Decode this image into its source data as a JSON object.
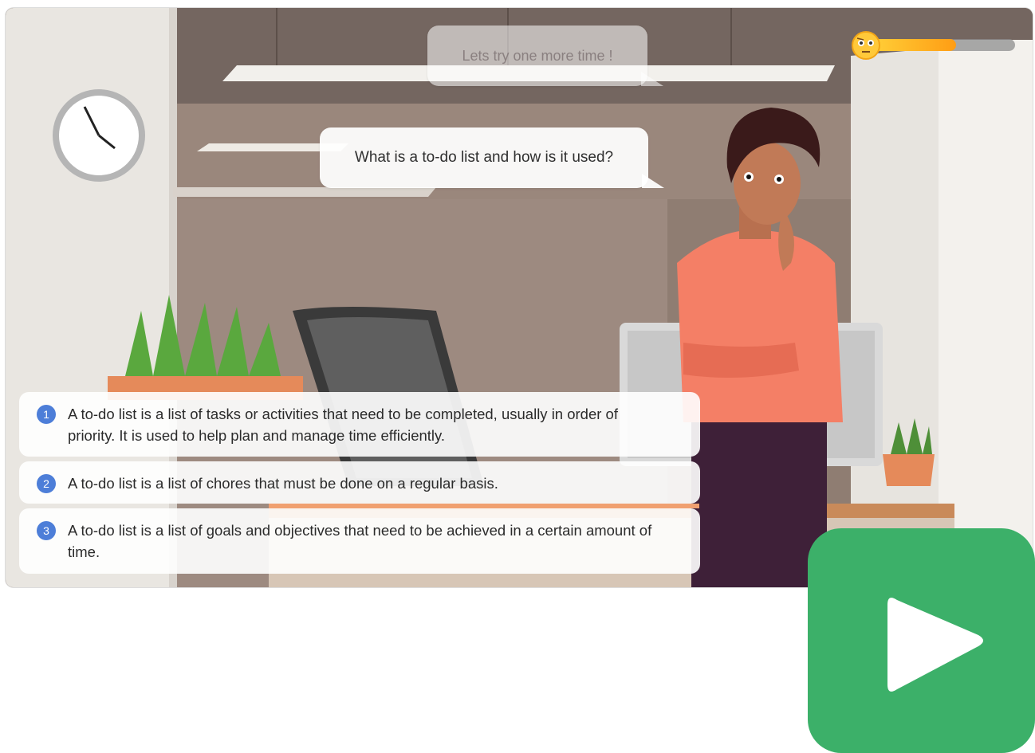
{
  "scene": {
    "previous_feedback": "Lets try one more time !",
    "question": "What is a to-do list and how is it used?"
  },
  "progress_meter": {
    "level": 0.6,
    "face_icon": "confused-face-icon"
  },
  "options": [
    {
      "number": "1",
      "text": "A to-do list is a list of tasks or activities that need to be completed, usually in order of priority. It is used to help plan and manage time efficiently."
    },
    {
      "number": "2",
      "text": "A to-do list is a list of chores that must be done on a regular basis."
    },
    {
      "number": "3",
      "text": "A to-do list is a list of goals and objectives that need to be achieved in a certain amount of time."
    }
  ],
  "play_button": {
    "icon": "play-icon",
    "color": "#3cb069"
  },
  "colors": {
    "accent": "#4d7ed8",
    "meter_fill": "#ff9d14"
  }
}
